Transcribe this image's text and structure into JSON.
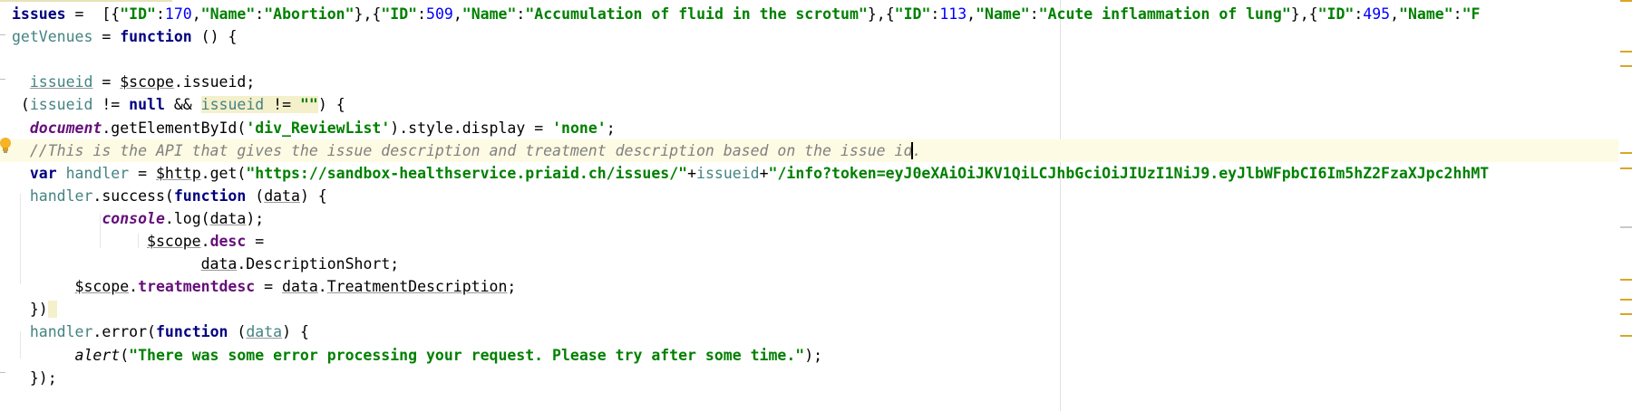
{
  "editor": {
    "lines": [
      {
        "tokens": [
          {
            "t": "issues",
            "c": "kw"
          },
          {
            "t": " =  [{",
            "c": "plain"
          },
          {
            "t": "\"ID\"",
            "c": "str"
          },
          {
            "t": ":",
            "c": "plain"
          },
          {
            "t": "170",
            "c": "num"
          },
          {
            "t": ",",
            "c": "plain"
          },
          {
            "t": "\"Name\"",
            "c": "str"
          },
          {
            "t": ":",
            "c": "plain"
          },
          {
            "t": "\"Abortion\"",
            "c": "str"
          },
          {
            "t": "},{",
            "c": "plain"
          },
          {
            "t": "\"ID\"",
            "c": "str"
          },
          {
            "t": ":",
            "c": "plain"
          },
          {
            "t": "509",
            "c": "num"
          },
          {
            "t": ",",
            "c": "plain"
          },
          {
            "t": "\"Name\"",
            "c": "str"
          },
          {
            "t": ":",
            "c": "plain"
          },
          {
            "t": "\"Accumulation of fluid in the scrotum\"",
            "c": "str"
          },
          {
            "t": "},{",
            "c": "plain"
          },
          {
            "t": "\"ID\"",
            "c": "str"
          },
          {
            "t": ":",
            "c": "plain"
          },
          {
            "t": "113",
            "c": "num"
          },
          {
            "t": ",",
            "c": "plain"
          },
          {
            "t": "\"Name\"",
            "c": "str"
          },
          {
            "t": ":",
            "c": "plain"
          },
          {
            "t": "\"Acute inflammation of lung\"",
            "c": "str"
          },
          {
            "t": "},{",
            "c": "plain"
          },
          {
            "t": "\"ID\"",
            "c": "str"
          },
          {
            "t": ":",
            "c": "plain"
          },
          {
            "t": "495",
            "c": "num"
          },
          {
            "t": ",",
            "c": "plain"
          },
          {
            "t": "\"Name\"",
            "c": "str"
          },
          {
            "t": ":",
            "c": "plain"
          },
          {
            "t": "\"F",
            "c": "str"
          }
        ]
      },
      {
        "tokens": [
          {
            "t": "getVenues",
            "c": "var"
          },
          {
            "t": " = ",
            "c": "plain"
          },
          {
            "t": "function",
            "c": "kw"
          },
          {
            "t": " () {",
            "c": "plain"
          }
        ]
      },
      {
        "tokens": []
      },
      {
        "tokens": [
          {
            "t": "  ",
            "c": "plain"
          },
          {
            "t": "issueid",
            "c": "var ul"
          },
          {
            "t": " = ",
            "c": "plain"
          },
          {
            "t": "$scope",
            "c": "plain ul"
          },
          {
            "t": ".issueid;",
            "c": "plain"
          }
        ]
      },
      {
        "tokens": [
          {
            "t": " (",
            "c": "plain"
          },
          {
            "t": "issueid",
            "c": "var"
          },
          {
            "t": " != ",
            "c": "plain"
          },
          {
            "t": "null",
            "c": "kw"
          },
          {
            "t": " && ",
            "c": "plain"
          },
          {
            "t": "issueid",
            "c": "var hl-bg"
          },
          {
            "t": " != ",
            "c": "plain hl-bg"
          },
          {
            "t": "\"\"",
            "c": "str hl-bg"
          },
          {
            "t": ") {",
            "c": "plain"
          }
        ]
      },
      {
        "tokens": [
          {
            "t": "  ",
            "c": "plain"
          },
          {
            "t": "document",
            "c": "glob"
          },
          {
            "t": ".getElementById(",
            "c": "plain"
          },
          {
            "t": "'div_ReviewList'",
            "c": "str"
          },
          {
            "t": ").style.display = ",
            "c": "plain"
          },
          {
            "t": "'none'",
            "c": "str"
          },
          {
            "t": ";",
            "c": "plain"
          }
        ]
      },
      {
        "tokens": [
          {
            "t": "  ",
            "c": "plain"
          },
          {
            "t": "//This is the API that gives the issue description and treatment description based on the issue id",
            "c": "cmt"
          },
          {
            "t": "|CARET|",
            "c": "caret"
          },
          {
            "t": ".",
            "c": "cmt"
          }
        ]
      },
      {
        "tokens": [
          {
            "t": "  ",
            "c": "plain"
          },
          {
            "t": "var",
            "c": "kw"
          },
          {
            "t": " ",
            "c": "plain"
          },
          {
            "t": "handler",
            "c": "var"
          },
          {
            "t": " = ",
            "c": "plain"
          },
          {
            "t": "$http",
            "c": "plain ul"
          },
          {
            "t": ".get(",
            "c": "plain"
          },
          {
            "t": "\"https://sandbox-healthservice.priaid.ch/issues/\"",
            "c": "str"
          },
          {
            "t": "+",
            "c": "plain"
          },
          {
            "t": "issueid",
            "c": "var"
          },
          {
            "t": "+",
            "c": "plain"
          },
          {
            "t": "\"/info?token=eyJ0eXAiOiJKV1QiLCJhbGciOiJIUzI1NiJ9.eyJlbWFpbCI6Im5hZ2FzaXJpc2hhMT",
            "c": "str"
          }
        ]
      },
      {
        "tokens": [
          {
            "t": "  ",
            "c": "plain"
          },
          {
            "t": "handler",
            "c": "var"
          },
          {
            "t": ".success(",
            "c": "plain"
          },
          {
            "t": "function",
            "c": "kw"
          },
          {
            "t": " (",
            "c": "plain"
          },
          {
            "t": "data",
            "c": "plain ul"
          },
          {
            "t": ") {",
            "c": "plain"
          }
        ]
      },
      {
        "tokens": [
          {
            "t": "          ",
            "c": "plain"
          },
          {
            "t": "console",
            "c": "glob"
          },
          {
            "t": ".log(",
            "c": "plain"
          },
          {
            "t": "data",
            "c": "plain ul"
          },
          {
            "t": ");",
            "c": "plain"
          }
        ]
      },
      {
        "tokens": [
          {
            "t": "               ",
            "c": "plain"
          },
          {
            "t": "$scope",
            "c": "plain ul"
          },
          {
            "t": ".",
            "c": "plain"
          },
          {
            "t": "desc",
            "c": "prop"
          },
          {
            "t": " =",
            "c": "plain"
          }
        ]
      },
      {
        "tokens": [
          {
            "t": "                     ",
            "c": "plain"
          },
          {
            "t": "data",
            "c": "plain ul"
          },
          {
            "t": ".DescriptionShort;",
            "c": "plain"
          }
        ]
      },
      {
        "tokens": [
          {
            "t": "       ",
            "c": "plain"
          },
          {
            "t": "$scope",
            "c": "plain ul"
          },
          {
            "t": ".",
            "c": "plain"
          },
          {
            "t": "treatmentdesc",
            "c": "prop"
          },
          {
            "t": " = ",
            "c": "plain"
          },
          {
            "t": "data",
            "c": "plain ul"
          },
          {
            "t": ".",
            "c": "plain"
          },
          {
            "t": "TreatmentDescription",
            "c": "plain ul"
          },
          {
            "t": ";",
            "c": "plain"
          }
        ]
      },
      {
        "tokens": [
          {
            "t": "  })",
            "c": "plain"
          },
          {
            "t": " ",
            "c": "hl-bg"
          }
        ]
      },
      {
        "tokens": [
          {
            "t": "  ",
            "c": "plain"
          },
          {
            "t": "handler",
            "c": "var"
          },
          {
            "t": ".error(",
            "c": "plain"
          },
          {
            "t": "function",
            "c": "kw"
          },
          {
            "t": " (",
            "c": "plain"
          },
          {
            "t": "data",
            "c": "var ul"
          },
          {
            "t": ") {",
            "c": "plain"
          }
        ]
      },
      {
        "tokens": [
          {
            "t": "       ",
            "c": "plain"
          },
          {
            "t": "alert",
            "c": "plain it"
          },
          {
            "t": "(",
            "c": "plain"
          },
          {
            "t": "\"There was some error processing your request. Please try after some time.\"",
            "c": "str"
          },
          {
            "t": ");",
            "c": "plain"
          }
        ]
      },
      {
        "tokens": [
          {
            "t": "  });",
            "c": "plain"
          }
        ]
      }
    ],
    "current_line": 6
  }
}
